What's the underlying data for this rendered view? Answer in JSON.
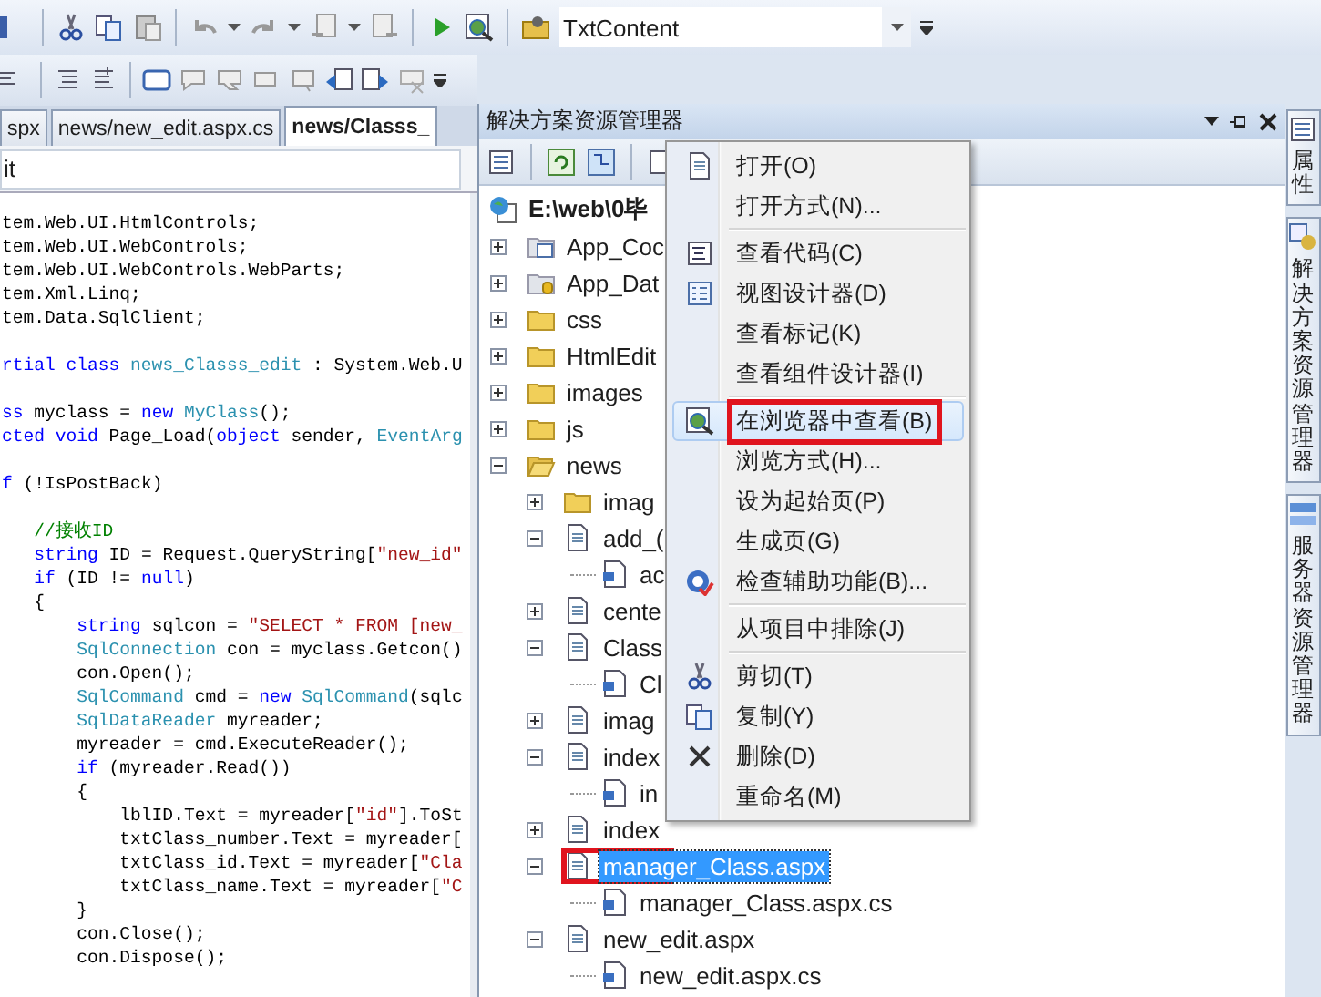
{
  "toolbar": {
    "combo": {
      "value": "TxtContent"
    }
  },
  "editor": {
    "tabs": [
      {
        "label": "spx",
        "selected": false
      },
      {
        "label": "news/new_edit.aspx.cs",
        "selected": false
      },
      {
        "label": "news/Classs_",
        "selected": true
      }
    ],
    "member_dropdown": {
      "value": "it"
    },
    "code_lines": [
      {
        "kind": "code",
        "segments": [
          {
            "text": "tem.Web.UI.HtmlControls;",
            "kind": "plain"
          }
        ]
      },
      {
        "kind": "code",
        "segments": [
          {
            "text": "tem.Web.UI.WebControls;",
            "kind": "plain"
          }
        ]
      },
      {
        "kind": "code",
        "segments": [
          {
            "text": "tem.Web.UI.WebControls.WebParts;",
            "kind": "plain"
          }
        ]
      },
      {
        "kind": "code",
        "segments": [
          {
            "text": "tem.Xml.Linq;",
            "kind": "plain"
          }
        ]
      },
      {
        "kind": "code",
        "segments": [
          {
            "text": "tem.Data.SqlClient;",
            "kind": "plain"
          }
        ]
      },
      {
        "kind": "blank"
      },
      {
        "kind": "code",
        "segments": [
          {
            "text": "rtial class",
            "kind": "keyword"
          },
          {
            "text": " news_Classs_edit",
            "kind": "type"
          },
          {
            "text": " : System.Web.U",
            "kind": "plain"
          }
        ]
      },
      {
        "kind": "blank"
      },
      {
        "kind": "code",
        "segments": [
          {
            "text": "ss",
            "kind": "keyword"
          },
          {
            "text": " myclass = ",
            "kind": "plain"
          },
          {
            "text": "new",
            "kind": "keyword"
          },
          {
            "text": " MyClass",
            "kind": "type"
          },
          {
            "text": "();",
            "kind": "plain"
          }
        ]
      },
      {
        "kind": "code",
        "segments": [
          {
            "text": "cted void",
            "kind": "keyword"
          },
          {
            "text": " Page_Load(",
            "kind": "plain"
          },
          {
            "text": "object",
            "kind": "keyword"
          },
          {
            "text": " sender, ",
            "kind": "plain"
          },
          {
            "text": "EventArg",
            "kind": "type"
          }
        ]
      },
      {
        "kind": "blank"
      },
      {
        "kind": "code",
        "segments": [
          {
            "text": "f",
            "kind": "keyword"
          },
          {
            "text": " (!IsPostBack)",
            "kind": "plain"
          }
        ]
      },
      {
        "kind": "blank"
      },
      {
        "kind": "code",
        "segments": [
          {
            "text": "   //接收ID",
            "kind": "comment"
          }
        ]
      },
      {
        "kind": "code",
        "segments": [
          {
            "text": "   string",
            "kind": "keyword"
          },
          {
            "text": " ID = Request.QueryString[",
            "kind": "plain"
          },
          {
            "text": "\"new_id\"",
            "kind": "string"
          }
        ]
      },
      {
        "kind": "code",
        "segments": [
          {
            "text": "   if",
            "kind": "keyword"
          },
          {
            "text": " (ID != ",
            "kind": "plain"
          },
          {
            "text": "null",
            "kind": "keyword"
          },
          {
            "text": ")",
            "kind": "plain"
          }
        ]
      },
      {
        "kind": "code",
        "segments": [
          {
            "text": "   {",
            "kind": "plain"
          }
        ]
      },
      {
        "kind": "code",
        "segments": [
          {
            "text": "       string",
            "kind": "keyword"
          },
          {
            "text": " sqlcon = ",
            "kind": "plain"
          },
          {
            "text": "\"SELECT * FROM [new_",
            "kind": "string"
          }
        ]
      },
      {
        "kind": "code",
        "segments": [
          {
            "text": "       SqlConnection",
            "kind": "type"
          },
          {
            "text": " con = myclass.Getcon()",
            "kind": "plain"
          }
        ]
      },
      {
        "kind": "code",
        "segments": [
          {
            "text": "       con.Open();",
            "kind": "plain"
          }
        ]
      },
      {
        "kind": "code",
        "segments": [
          {
            "text": "       SqlCommand",
            "kind": "type"
          },
          {
            "text": " cmd = ",
            "kind": "plain"
          },
          {
            "text": "new",
            "kind": "keyword"
          },
          {
            "text": " SqlCommand",
            "kind": "type"
          },
          {
            "text": "(sqlc",
            "kind": "plain"
          }
        ]
      },
      {
        "kind": "code",
        "segments": [
          {
            "text": "       SqlDataReader",
            "kind": "type"
          },
          {
            "text": " myreader;",
            "kind": "plain"
          }
        ]
      },
      {
        "kind": "code",
        "segments": [
          {
            "text": "       myreader = cmd.ExecuteReader();",
            "kind": "plain"
          }
        ]
      },
      {
        "kind": "code",
        "segments": [
          {
            "text": "       if",
            "kind": "keyword"
          },
          {
            "text": " (myreader.Read())",
            "kind": "plain"
          }
        ]
      },
      {
        "kind": "code",
        "segments": [
          {
            "text": "       {",
            "kind": "plain"
          }
        ]
      },
      {
        "kind": "code",
        "segments": [
          {
            "text": "           lblID.Text = myreader[",
            "kind": "plain"
          },
          {
            "text": "\"id\"",
            "kind": "string"
          },
          {
            "text": "].ToSt",
            "kind": "plain"
          }
        ]
      },
      {
        "kind": "code",
        "segments": [
          {
            "text": "           txtClass_number.Text = myreader[",
            "kind": "plain"
          }
        ]
      },
      {
        "kind": "code",
        "segments": [
          {
            "text": "           txtClass_id.Text = myreader[",
            "kind": "plain"
          },
          {
            "text": "\"Cla",
            "kind": "string"
          }
        ]
      },
      {
        "kind": "code",
        "segments": [
          {
            "text": "           txtClass_name.Text = myreader[",
            "kind": "plain"
          },
          {
            "text": "\"C",
            "kind": "string"
          }
        ]
      },
      {
        "kind": "code",
        "segments": [
          {
            "text": "       }",
            "kind": "plain"
          }
        ]
      },
      {
        "kind": "code",
        "segments": [
          {
            "text": "       con.Close();",
            "kind": "plain"
          }
        ]
      },
      {
        "kind": "code",
        "segments": [
          {
            "text": "       con.Dispose();",
            "kind": "plain"
          }
        ]
      }
    ]
  },
  "solution_explorer": {
    "title": "解决方案资源管理器",
    "tree": {
      "label": "E:\\web\\0毕",
      "kind": "site",
      "selected": false,
      "marked": false,
      "children": [
        {
          "label": "App_Coc",
          "kind": "special-folder",
          "expanded": false,
          "selected": false,
          "marked": false
        },
        {
          "label": "App_Dat",
          "kind": "data-folder",
          "expanded": false,
          "selected": false,
          "marked": false
        },
        {
          "label": "css",
          "kind": "folder",
          "expanded": false,
          "selected": false,
          "marked": false
        },
        {
          "label": "HtmlEdit",
          "kind": "folder",
          "expanded": false,
          "selected": false,
          "marked": false
        },
        {
          "label": "images",
          "kind": "folder",
          "expanded": false,
          "selected": false,
          "marked": false
        },
        {
          "label": "js",
          "kind": "folder",
          "expanded": false,
          "selected": false,
          "marked": false
        },
        {
          "label": "news",
          "kind": "folder",
          "expanded": true,
          "selected": false,
          "marked": false,
          "children": [
            {
              "label": "imag",
              "kind": "folder",
              "expanded": false,
              "selected": false,
              "marked": false
            },
            {
              "label": "add_(",
              "kind": "page",
              "expanded": true,
              "selected": false,
              "marked": false,
              "children": [
                {
                  "label": "ac",
                  "kind": "code-file",
                  "selected": false,
                  "marked": false
                }
              ]
            },
            {
              "label": "cente",
              "kind": "page",
              "expanded": false,
              "selected": false,
              "marked": false
            },
            {
              "label": "Class",
              "kind": "page",
              "expanded": true,
              "selected": false,
              "marked": false,
              "children": [
                {
                  "label": "Cl",
                  "kind": "code-file",
                  "selected": false,
                  "marked": false
                }
              ]
            },
            {
              "label": "imag",
              "kind": "page",
              "expanded": false,
              "selected": false,
              "marked": false
            },
            {
              "label": "index",
              "kind": "page",
              "expanded": true,
              "selected": false,
              "marked": false,
              "children": [
                {
                  "label": "in",
                  "kind": "code-file",
                  "selected": false,
                  "marked": false
                }
              ]
            },
            {
              "label": "index",
              "kind": "page",
              "expanded": false,
              "selected": false,
              "marked": false
            },
            {
              "label": "manager_Class.aspx",
              "kind": "page",
              "expanded": true,
              "selected": true,
              "marked": true,
              "children": [
                {
                  "label": "manager_Class.aspx.cs",
                  "kind": "code-file",
                  "selected": false,
                  "marked": false
                }
              ]
            },
            {
              "label": "new_edit.aspx",
              "kind": "page",
              "expanded": true,
              "selected": false,
              "marked": false,
              "children": [
                {
                  "label": "new_edit.aspx.cs",
                  "kind": "code-file",
                  "selected": false,
                  "marked": false
                }
              ]
            }
          ]
        }
      ]
    }
  },
  "context_menu": {
    "groups": [
      [
        {
          "label": "打开(O)",
          "kind": "page",
          "selected": false,
          "marked": false
        },
        {
          "label": "打开方式(N)...",
          "kind": "plain",
          "selected": false,
          "marked": false
        }
      ],
      [
        {
          "label": "查看代码(C)",
          "kind": "code",
          "selected": false,
          "marked": false
        },
        {
          "label": "视图设计器(D)",
          "kind": "designer",
          "selected": false,
          "marked": false
        },
        {
          "label": "查看标记(K)",
          "kind": "plain",
          "selected": false,
          "marked": false
        },
        {
          "label": "查看组件设计器(I)",
          "kind": "plain",
          "selected": false,
          "marked": false
        }
      ],
      [
        {
          "label": "在浏览器中查看(B)",
          "kind": "browser",
          "selected": true,
          "marked": true
        },
        {
          "label": "浏览方式(H)...",
          "kind": "plain",
          "selected": false,
          "marked": false
        },
        {
          "label": "设为起始页(P)",
          "kind": "plain",
          "selected": false,
          "marked": false
        },
        {
          "label": "生成页(G)",
          "kind": "plain",
          "selected": false,
          "marked": false
        },
        {
          "label": "检查辅助功能(B)...",
          "kind": "accessibility",
          "selected": false,
          "marked": false
        }
      ],
      [
        {
          "label": "从项目中排除(J)",
          "kind": "plain",
          "selected": false,
          "marked": false
        }
      ],
      [
        {
          "label": "剪切(T)",
          "kind": "scissors",
          "selected": false,
          "marked": false
        },
        {
          "label": "复制(Y)",
          "kind": "copy",
          "selected": false,
          "marked": false
        },
        {
          "label": "删除(D)",
          "kind": "delete",
          "selected": false,
          "marked": false
        },
        {
          "label": "重命名(M)",
          "kind": "plain",
          "selected": false,
          "marked": false
        }
      ]
    ]
  },
  "side_tabs": [
    {
      "label": "属性"
    },
    {
      "label": "解决方案资源管理器"
    },
    {
      "label": "服务器资源管理器"
    }
  ]
}
